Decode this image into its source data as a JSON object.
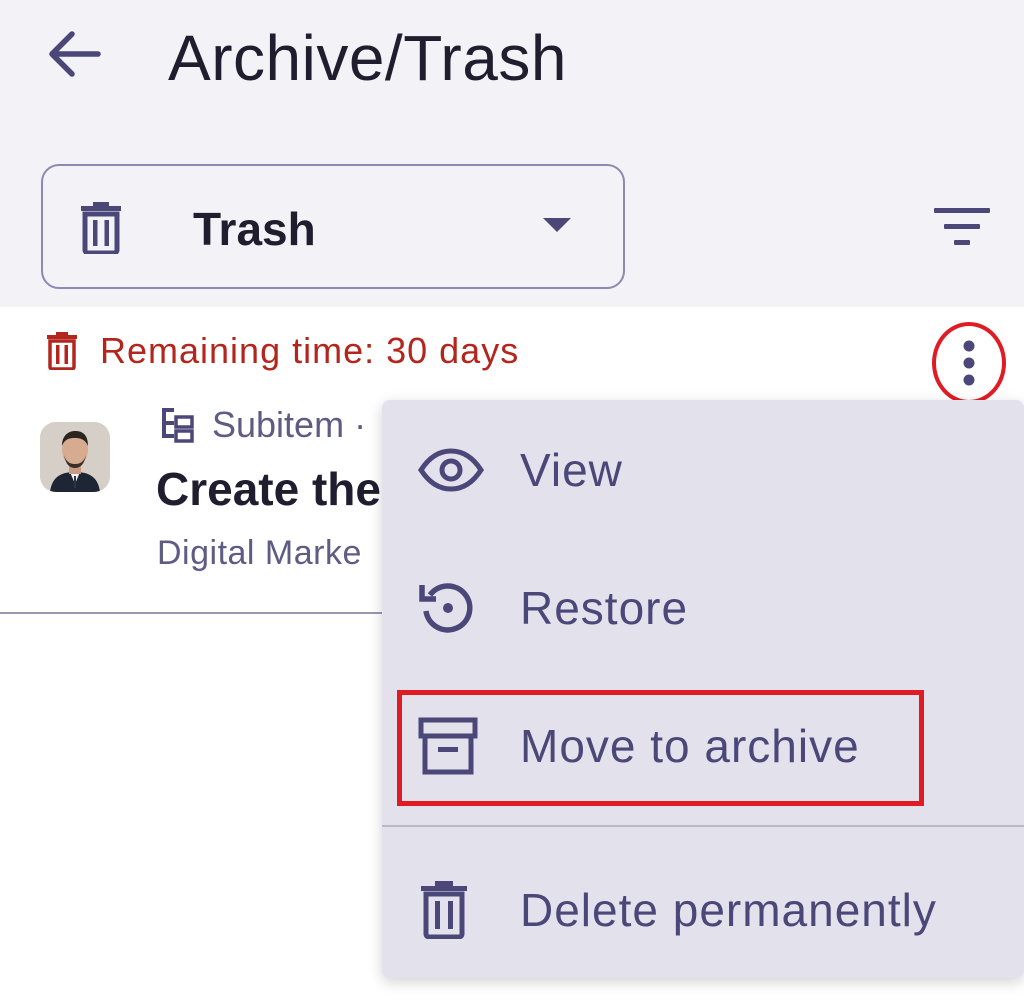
{
  "header": {
    "title": "Archive/Trash",
    "back_icon": "arrow-left-icon"
  },
  "selector": {
    "icon": "trash-icon",
    "value": "Trash"
  },
  "item": {
    "remaining_label": "Remaining time: 30 days",
    "subitem_label": "Subitem ·",
    "title": "Create the",
    "board": "Digital Marke"
  },
  "menu": {
    "items": [
      {
        "label": "View",
        "icon": "eye-icon"
      },
      {
        "label": "Restore",
        "icon": "restore-icon"
      },
      {
        "label": "Move to archive",
        "icon": "archive-box-icon"
      },
      {
        "label": "Delete permanently",
        "icon": "trash-icon"
      }
    ]
  },
  "colors": {
    "header_bg": "#f3f2f7",
    "accent": "#4b4879",
    "warning": "#b3261e",
    "highlight": "#e01b24",
    "menu_bg": "#e3e2ec"
  }
}
